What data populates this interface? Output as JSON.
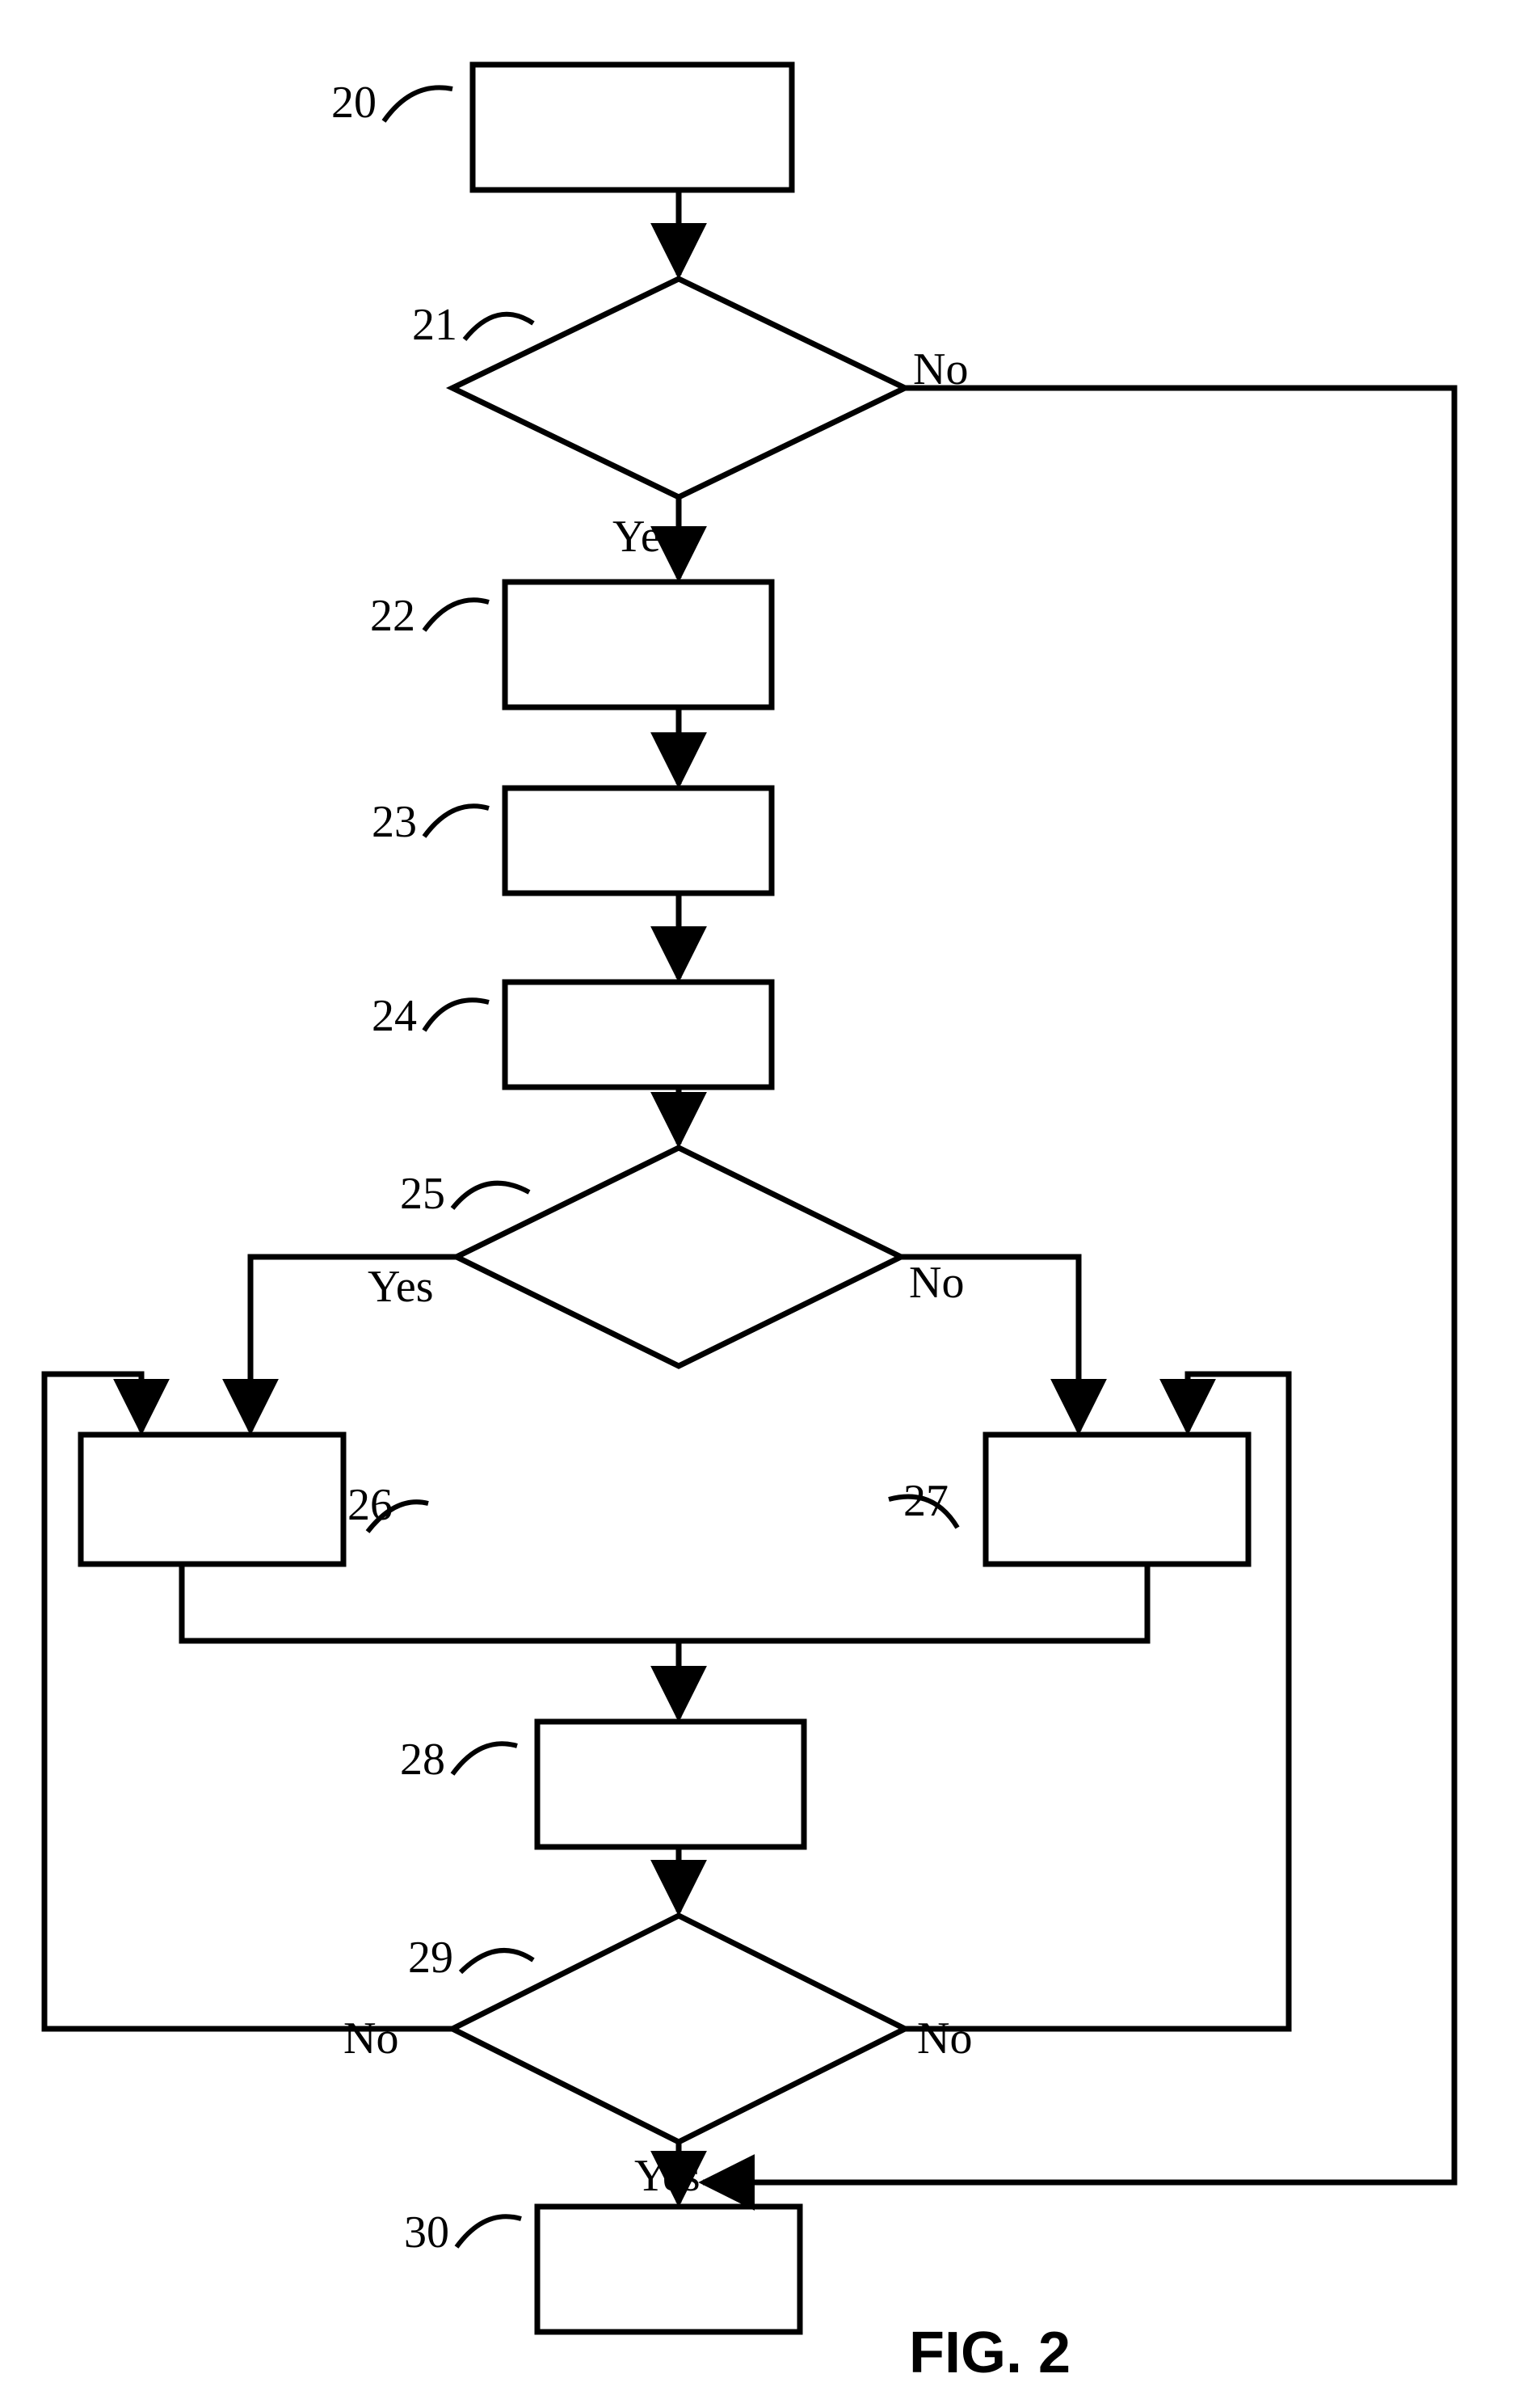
{
  "figure_caption": "FIG. 2",
  "nodes": {
    "n20": {
      "ref": "20"
    },
    "n21": {
      "ref": "21"
    },
    "n22": {
      "ref": "22"
    },
    "n23": {
      "ref": "23"
    },
    "n24": {
      "ref": "24"
    },
    "n25": {
      "ref": "25"
    },
    "n26": {
      "ref": "26"
    },
    "n27": {
      "ref": "27"
    },
    "n28": {
      "ref": "28"
    },
    "n29": {
      "ref": "29"
    },
    "n30": {
      "ref": "30"
    }
  },
  "edges": {
    "d21_yes": "Yes",
    "d21_no": "No",
    "d25_yes": "Yes",
    "d25_no": "No",
    "d29_yes": "Yes",
    "d29_no_left": "No",
    "d29_no_right": "No"
  }
}
